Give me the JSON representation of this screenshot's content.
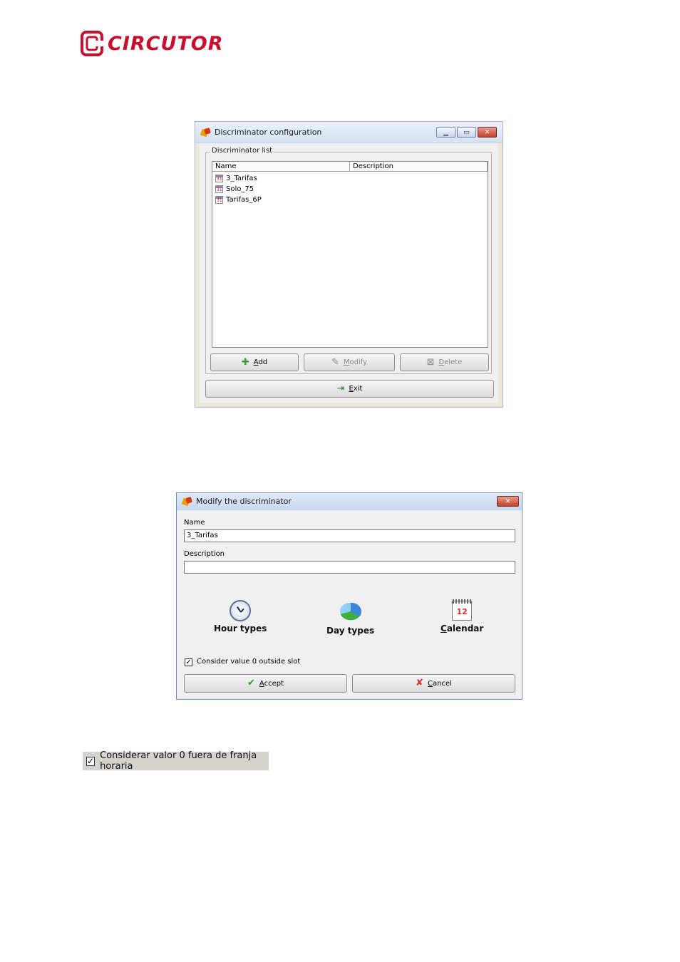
{
  "brand": {
    "logo_text": "CIRCUTOR"
  },
  "window1": {
    "title": "Discriminator configuration",
    "group_label": "Discriminator list",
    "columns": [
      "Name",
      "Description"
    ],
    "items": [
      {
        "name": "3_Tarifas",
        "description": ""
      },
      {
        "name": "Solo_75",
        "description": ""
      },
      {
        "name": "Tarifas_6P",
        "description": ""
      }
    ],
    "buttons": {
      "add": {
        "label": "Add",
        "hotkey": "A",
        "rest": "dd",
        "enabled": true
      },
      "modify": {
        "label": "Modify",
        "hotkey": "M",
        "rest": "odify",
        "enabled": false
      },
      "delete": {
        "label": "Delete",
        "hotkey": "D",
        "rest": "elete",
        "enabled": false
      },
      "exit": {
        "label": "Exit",
        "hotkey": "E",
        "rest": "xit",
        "enabled": true
      }
    }
  },
  "window2": {
    "title": "Modify the discriminator",
    "name_label": "Name",
    "name_value": "3_Tarifas",
    "description_label": "Description",
    "description_value": "",
    "hour_types": "Hour types",
    "day_types": "Day types",
    "calendar": {
      "label": "Calendar",
      "hotkey": "C",
      "rest": "alendar",
      "icon_number": "12"
    },
    "consider_zero": {
      "label": "Consider value 0 outside slot",
      "checked": true
    },
    "accept": {
      "label": "Accept",
      "hotkey": "A",
      "rest": "ccept"
    },
    "cancel": {
      "label": "Cancel",
      "hotkey": "C",
      "rest": "ancel"
    }
  },
  "snippet": {
    "label": "Considerar valor 0 fuera de franja horaria",
    "checked": true
  },
  "colors": {
    "brand_red": "#c8102e",
    "add_green": "#2e9e2e",
    "cancel_red": "#d32f2f"
  }
}
